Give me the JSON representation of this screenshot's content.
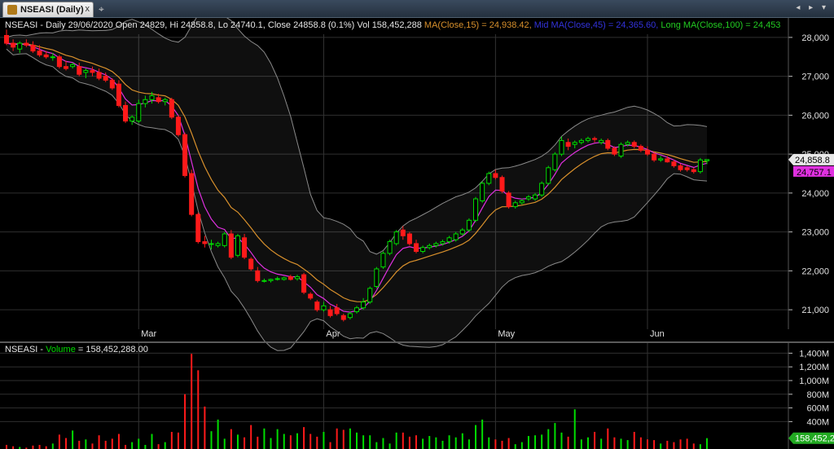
{
  "window": {
    "tab_title": "NSEASI (Daily)",
    "close_glyph": "x",
    "add_glyph": "⌖",
    "nav_glyph": "◂ ▸ ▾"
  },
  "header": {
    "text_main": "NSEASI - Daily 29/06/2020 Open 24829, Hi 24858.8, Lo 24740.1, Close 24858.8 (0.1%) Vol 158,452,288 ",
    "text_ma15": "MA(Close,15) = 24,938.42, ",
    "text_ma45": "Mid MA(Close,45) = 24,365.60, ",
    "text_ma100": "Long MA(Close,100) = 24,453"
  },
  "volume_header": {
    "text_sym": "NSEASI - ",
    "text_label": "Volume",
    "text_value": " = 158,452,288.00"
  },
  "colors": {
    "up": "#00dd00",
    "down": "#ff1a1a",
    "ma15": "#e030e0",
    "ma45": "#d8902c",
    "band": "#8a8a8a",
    "grid": "#2f2f2f",
    "panel_bg": "#000000",
    "band_fill": "rgba(255,255,255,0.06)",
    "header_ma15": "#d8902c",
    "header_ma45": "#3333dd",
    "header_ma100": "#22cc22",
    "last_price_box": "#e8e8e8",
    "ma_price_box": "#e030e0",
    "vol_value_box": "#22aa22"
  },
  "chart_data": [
    {
      "type": "candlestick",
      "title": "NSEASI (Daily)",
      "ylim": [
        20500,
        28500
      ],
      "y_ticks": [
        21000,
        22000,
        23000,
        24000,
        25000,
        26000,
        27000,
        28000
      ],
      "y_tick_labels": [
        "21,000",
        "22,000",
        "23,000",
        "24,000",
        "25,000",
        "26,000",
        "27,000",
        "28,000"
      ],
      "month_labels": [
        "Mar",
        "Apr",
        "May",
        "Jun"
      ],
      "month_tick_index": [
        20,
        48,
        74,
        97
      ],
      "last_price": 24858.8,
      "last_price_label": "24,858.8",
      "ma_price_label": "24,757.1",
      "candles": [
        {
          "o": 28050,
          "h": 28200,
          "l": 27800,
          "c": 27850
        },
        {
          "o": 27850,
          "h": 27950,
          "l": 27650,
          "c": 27750
        },
        {
          "o": 27700,
          "h": 27900,
          "l": 27600,
          "c": 27850
        },
        {
          "o": 27850,
          "h": 27950,
          "l": 27750,
          "c": 27800
        },
        {
          "o": 27800,
          "h": 27900,
          "l": 27600,
          "c": 27650
        },
        {
          "o": 27650,
          "h": 27800,
          "l": 27500,
          "c": 27550
        },
        {
          "o": 27550,
          "h": 27650,
          "l": 27450,
          "c": 27500
        },
        {
          "o": 27500,
          "h": 27600,
          "l": 27400,
          "c": 27500
        },
        {
          "o": 27500,
          "h": 27550,
          "l": 27200,
          "c": 27250
        },
        {
          "o": 27250,
          "h": 27400,
          "l": 27150,
          "c": 27200
        },
        {
          "o": 27250,
          "h": 27350,
          "l": 27200,
          "c": 27300
        },
        {
          "o": 27250,
          "h": 27350,
          "l": 27000,
          "c": 27050
        },
        {
          "o": 27100,
          "h": 27200,
          "l": 26950,
          "c": 27150
        },
        {
          "o": 27150,
          "h": 27250,
          "l": 27000,
          "c": 27100
        },
        {
          "o": 27100,
          "h": 27200,
          "l": 26900,
          "c": 26950
        },
        {
          "o": 27000,
          "h": 27100,
          "l": 26850,
          "c": 26900
        },
        {
          "o": 26900,
          "h": 26950,
          "l": 26650,
          "c": 26700
        },
        {
          "o": 26800,
          "h": 26900,
          "l": 26200,
          "c": 26250
        },
        {
          "o": 26250,
          "h": 26350,
          "l": 25800,
          "c": 25850
        },
        {
          "o": 25850,
          "h": 26000,
          "l": 25750,
          "c": 25950
        },
        {
          "o": 25850,
          "h": 26400,
          "l": 25800,
          "c": 26300
        },
        {
          "o": 26300,
          "h": 26500,
          "l": 26200,
          "c": 26400
        },
        {
          "o": 26400,
          "h": 26600,
          "l": 26300,
          "c": 26500
        },
        {
          "o": 26450,
          "h": 26550,
          "l": 26300,
          "c": 26350
        },
        {
          "o": 26350,
          "h": 26450,
          "l": 26250,
          "c": 26400
        },
        {
          "o": 26400,
          "h": 26450,
          "l": 25900,
          "c": 25950
        },
        {
          "o": 25950,
          "h": 26000,
          "l": 25450,
          "c": 25500
        },
        {
          "o": 25500,
          "h": 25550,
          "l": 24400,
          "c": 24450
        },
        {
          "o": 24500,
          "h": 24600,
          "l": 23400,
          "c": 23450
        },
        {
          "o": 23450,
          "h": 23500,
          "l": 22700,
          "c": 22750
        },
        {
          "o": 22750,
          "h": 22900,
          "l": 22600,
          "c": 22700
        },
        {
          "o": 22700,
          "h": 22800,
          "l": 22550,
          "c": 22700
        },
        {
          "o": 22650,
          "h": 22750,
          "l": 22600,
          "c": 22700
        },
        {
          "o": 22650,
          "h": 23000,
          "l": 22600,
          "c": 22950
        },
        {
          "o": 22950,
          "h": 23050,
          "l": 22300,
          "c": 22350
        },
        {
          "o": 22400,
          "h": 22950,
          "l": 22350,
          "c": 22900
        },
        {
          "o": 22850,
          "h": 22950,
          "l": 22300,
          "c": 22350
        },
        {
          "o": 22300,
          "h": 22350,
          "l": 22000,
          "c": 22050
        },
        {
          "o": 22000,
          "h": 22100,
          "l": 21700,
          "c": 21750
        },
        {
          "o": 21750,
          "h": 21800,
          "l": 21700,
          "c": 21750
        },
        {
          "o": 21750,
          "h": 21800,
          "l": 21700,
          "c": 21780
        },
        {
          "o": 21780,
          "h": 21850,
          "l": 21750,
          "c": 21800
        },
        {
          "o": 21780,
          "h": 21850,
          "l": 21750,
          "c": 21820
        },
        {
          "o": 21850,
          "h": 21900,
          "l": 21750,
          "c": 21780
        },
        {
          "o": 21800,
          "h": 21900,
          "l": 21750,
          "c": 21850
        },
        {
          "o": 21900,
          "h": 21950,
          "l": 21400,
          "c": 21450
        },
        {
          "o": 21400,
          "h": 21450,
          "l": 21250,
          "c": 21300
        },
        {
          "o": 21200,
          "h": 21250,
          "l": 20950,
          "c": 21000
        },
        {
          "o": 21000,
          "h": 21200,
          "l": 20950,
          "c": 21100
        },
        {
          "o": 21000,
          "h": 21100,
          "l": 20800,
          "c": 20850
        },
        {
          "o": 21050,
          "h": 21150,
          "l": 20850,
          "c": 20900
        },
        {
          "o": 20850,
          "h": 20900,
          "l": 20700,
          "c": 20750
        },
        {
          "o": 20800,
          "h": 20950,
          "l": 20750,
          "c": 20900
        },
        {
          "o": 20950,
          "h": 21100,
          "l": 20900,
          "c": 21050
        },
        {
          "o": 21050,
          "h": 21300,
          "l": 21000,
          "c": 21200
        },
        {
          "o": 21200,
          "h": 21600,
          "l": 21150,
          "c": 21550
        },
        {
          "o": 21600,
          "h": 22100,
          "l": 21550,
          "c": 22050
        },
        {
          "o": 22100,
          "h": 22500,
          "l": 22050,
          "c": 22450
        },
        {
          "o": 22450,
          "h": 22800,
          "l": 22400,
          "c": 22750
        },
        {
          "o": 22700,
          "h": 23050,
          "l": 22650,
          "c": 23000
        },
        {
          "o": 23050,
          "h": 23150,
          "l": 22800,
          "c": 22900
        },
        {
          "o": 22950,
          "h": 23000,
          "l": 22650,
          "c": 22700
        },
        {
          "o": 22700,
          "h": 22800,
          "l": 22450,
          "c": 22500
        },
        {
          "o": 22500,
          "h": 22650,
          "l": 22450,
          "c": 22600
        },
        {
          "o": 22600,
          "h": 22700,
          "l": 22550,
          "c": 22650
        },
        {
          "o": 22650,
          "h": 22750,
          "l": 22600,
          "c": 22700
        },
        {
          "o": 22700,
          "h": 22800,
          "l": 22650,
          "c": 22750
        },
        {
          "o": 22750,
          "h": 22900,
          "l": 22700,
          "c": 22850
        },
        {
          "o": 22800,
          "h": 23000,
          "l": 22750,
          "c": 22950
        },
        {
          "o": 22950,
          "h": 23100,
          "l": 22900,
          "c": 23050
        },
        {
          "o": 23050,
          "h": 23350,
          "l": 23000,
          "c": 23300
        },
        {
          "o": 23300,
          "h": 23900,
          "l": 23250,
          "c": 23850
        },
        {
          "o": 23800,
          "h": 24300,
          "l": 23750,
          "c": 24250
        },
        {
          "o": 24250,
          "h": 24550,
          "l": 24200,
          "c": 24500
        },
        {
          "o": 24500,
          "h": 24600,
          "l": 24350,
          "c": 24400
        },
        {
          "o": 24400,
          "h": 24450,
          "l": 24000,
          "c": 24050
        },
        {
          "o": 24000,
          "h": 24050,
          "l": 23600,
          "c": 23650
        },
        {
          "o": 23650,
          "h": 23800,
          "l": 23600,
          "c": 23750
        },
        {
          "o": 23750,
          "h": 23850,
          "l": 23700,
          "c": 23800
        },
        {
          "o": 23850,
          "h": 23950,
          "l": 23800,
          "c": 23900
        },
        {
          "o": 23850,
          "h": 24000,
          "l": 23800,
          "c": 23950
        },
        {
          "o": 23950,
          "h": 24300,
          "l": 23900,
          "c": 24250
        },
        {
          "o": 24250,
          "h": 24700,
          "l": 24200,
          "c": 24650
        },
        {
          "o": 24600,
          "h": 25050,
          "l": 24550,
          "c": 25000
        },
        {
          "o": 25000,
          "h": 25450,
          "l": 24950,
          "c": 25350
        },
        {
          "o": 25300,
          "h": 25400,
          "l": 25100,
          "c": 25200
        },
        {
          "o": 25250,
          "h": 25350,
          "l": 25150,
          "c": 25300
        },
        {
          "o": 25300,
          "h": 25400,
          "l": 25250,
          "c": 25350
        },
        {
          "o": 25350,
          "h": 25450,
          "l": 25300,
          "c": 25400
        },
        {
          "o": 25400,
          "h": 25450,
          "l": 25300,
          "c": 25380
        },
        {
          "o": 25300,
          "h": 25400,
          "l": 25250,
          "c": 25350
        },
        {
          "o": 25350,
          "h": 25400,
          "l": 25100,
          "c": 25150
        },
        {
          "o": 25150,
          "h": 25200,
          "l": 24950,
          "c": 25000
        },
        {
          "o": 24950,
          "h": 25300,
          "l": 24900,
          "c": 25250
        },
        {
          "o": 25250,
          "h": 25350,
          "l": 25200,
          "c": 25300
        },
        {
          "o": 25300,
          "h": 25350,
          "l": 25150,
          "c": 25200
        },
        {
          "o": 25200,
          "h": 25250,
          "l": 25050,
          "c": 25100
        },
        {
          "o": 25100,
          "h": 25200,
          "l": 24950,
          "c": 25000
        },
        {
          "o": 25000,
          "h": 25050,
          "l": 24800,
          "c": 24850
        },
        {
          "o": 24850,
          "h": 24950,
          "l": 24800,
          "c": 24880
        },
        {
          "o": 24880,
          "h": 24950,
          "l": 24780,
          "c": 24800
        },
        {
          "o": 24800,
          "h": 24850,
          "l": 24650,
          "c": 24700
        },
        {
          "o": 24700,
          "h": 24750,
          "l": 24550,
          "c": 24600
        },
        {
          "o": 24650,
          "h": 24700,
          "l": 24550,
          "c": 24600
        },
        {
          "o": 24600,
          "h": 24650,
          "l": 24500,
          "c": 24550
        },
        {
          "o": 24550,
          "h": 24900,
          "l": 24500,
          "c": 24850
        },
        {
          "o": 24829,
          "h": 24858.8,
          "l": 24740.1,
          "c": 24858.8
        }
      ]
    },
    {
      "type": "bar",
      "title": "Volume",
      "ylim": [
        0,
        1500
      ],
      "y_ticks": [
        400,
        600,
        800,
        1000,
        1200,
        1400
      ],
      "y_tick_labels": [
        "400M",
        "600M",
        "800M",
        "1,000M",
        "1,200M",
        "1,400M"
      ],
      "last_value_label": "158,452,2",
      "values_millions": [
        60,
        40,
        30,
        20,
        50,
        60,
        40,
        80,
        210,
        160,
        270,
        120,
        140,
        80,
        200,
        120,
        150,
        220,
        60,
        100,
        150,
        60,
        220,
        70,
        100,
        250,
        240,
        800,
        1390,
        1150,
        620,
        260,
        430,
        150,
        290,
        210,
        170,
        350,
        180,
        300,
        160,
        290,
        220,
        200,
        230,
        320,
        220,
        180,
        250,
        100,
        300,
        280,
        300,
        240,
        200,
        200,
        100,
        160,
        80,
        240,
        240,
        180,
        200,
        150,
        190,
        170,
        120,
        200,
        170,
        230,
        140,
        350,
        430,
        170,
        140,
        120,
        160,
        70,
        100,
        190,
        200,
        210,
        290,
        380,
        240,
        180,
        580,
        140,
        170,
        250,
        150,
        300,
        170,
        150,
        130,
        250,
        170,
        140,
        130,
        80,
        120,
        100,
        140,
        150,
        80,
        70,
        158.45
      ]
    }
  ]
}
